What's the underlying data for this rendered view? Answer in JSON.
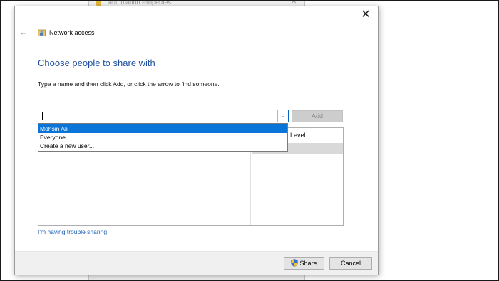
{
  "background_window": {
    "title": "automation Properties",
    "close_glyph": "✕"
  },
  "dialog": {
    "close_glyph": "✕",
    "back_glyph": "←",
    "header_title": "Network access",
    "page_title": "Choose people to share with",
    "instructions": "Type a name and then click Add, or click the arrow to find someone.",
    "combo": {
      "value": "",
      "arrow_glyph": "⌄"
    },
    "add_label": "Add",
    "list": {
      "level_header": "Level"
    },
    "dropdown_options": [
      "Mohsin Ali",
      "Everyone",
      "Create a new user..."
    ],
    "selected_option": "Mohsin Ali",
    "trouble_link": "I'm having trouble sharing",
    "share_label": "Share",
    "cancel_label": "Cancel"
  },
  "colors": {
    "title_blue": "#1f4e9e",
    "selection_blue": "#0a74d9",
    "link_blue": "#1a5fb4",
    "focus_border": "#0a64c8"
  },
  "icons": {
    "header": "network-user-icon",
    "back": "back-arrow-icon",
    "close": "close-icon",
    "share": "uac-shield-icon"
  }
}
